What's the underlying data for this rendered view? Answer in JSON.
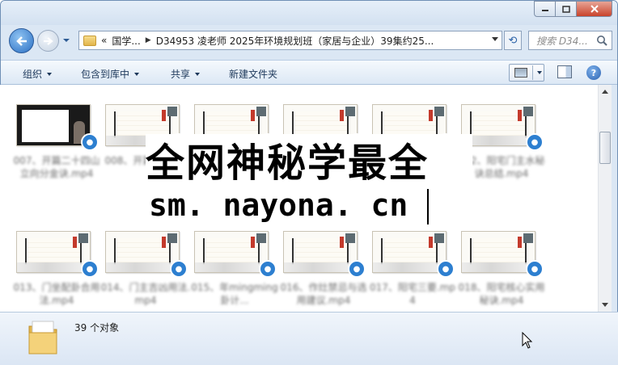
{
  "window": {
    "address_path": [
      "«",
      "国学...",
      "D34953 凌老师 2025年环境规划班（家居与企业）39集约25..."
    ],
    "search_placeholder": "搜索 D34...",
    "caption_icons": [
      "minimize-icon",
      "maximize-icon",
      "close-icon"
    ]
  },
  "toolbar": {
    "organize": "组织",
    "include_library": "包含到库中",
    "share": "共享",
    "new_folder": "新建文件夹",
    "help": "?"
  },
  "files": [
    {
      "label": "007、开篇二十四山立向分金诀.mp4",
      "thumb_style": "dark"
    },
    {
      "label": "008、开篇... mp4",
      "thumb_style": "scroll"
    },
    {
      "label": "009、二十八宿分金真诀.mp4",
      "thumb_style": "scroll"
    },
    {
      "label": "010、天星秘诀真诀.mp4",
      "thumb_style": "scroll"
    },
    {
      "label": "011、阳宅风水秘传.mp4",
      "thumb_style": "scroll"
    },
    {
      "label": "012、阳宅门主水秘诀总结.mp4",
      "thumb_style": "scroll"
    },
    {
      "label": "013、门坐配卦合用法.mp4",
      "thumb_style": "scroll"
    },
    {
      "label": "014、门主吉凶用法.mp4",
      "thumb_style": "scroll"
    },
    {
      "label": "015、年mingming卦计...",
      "thumb_style": "scroll"
    },
    {
      "label": "016、作灶禁忌与选用建议.mp4",
      "thumb_style": "scroll"
    },
    {
      "label": "017、阳宅三要.mp4",
      "thumb_style": "scroll"
    },
    {
      "label": "018、阳宅核心实用秘诀.mp4",
      "thumb_style": "scroll"
    }
  ],
  "watermark": {
    "line1": "全网神秘学最全",
    "line2": "sm. nayona. cn"
  },
  "details": {
    "item_count": "39 个对象"
  },
  "colors": {
    "accent": "#2d7fd0",
    "close_button": "#c9432b",
    "toolbar_text": "#1e395b"
  }
}
